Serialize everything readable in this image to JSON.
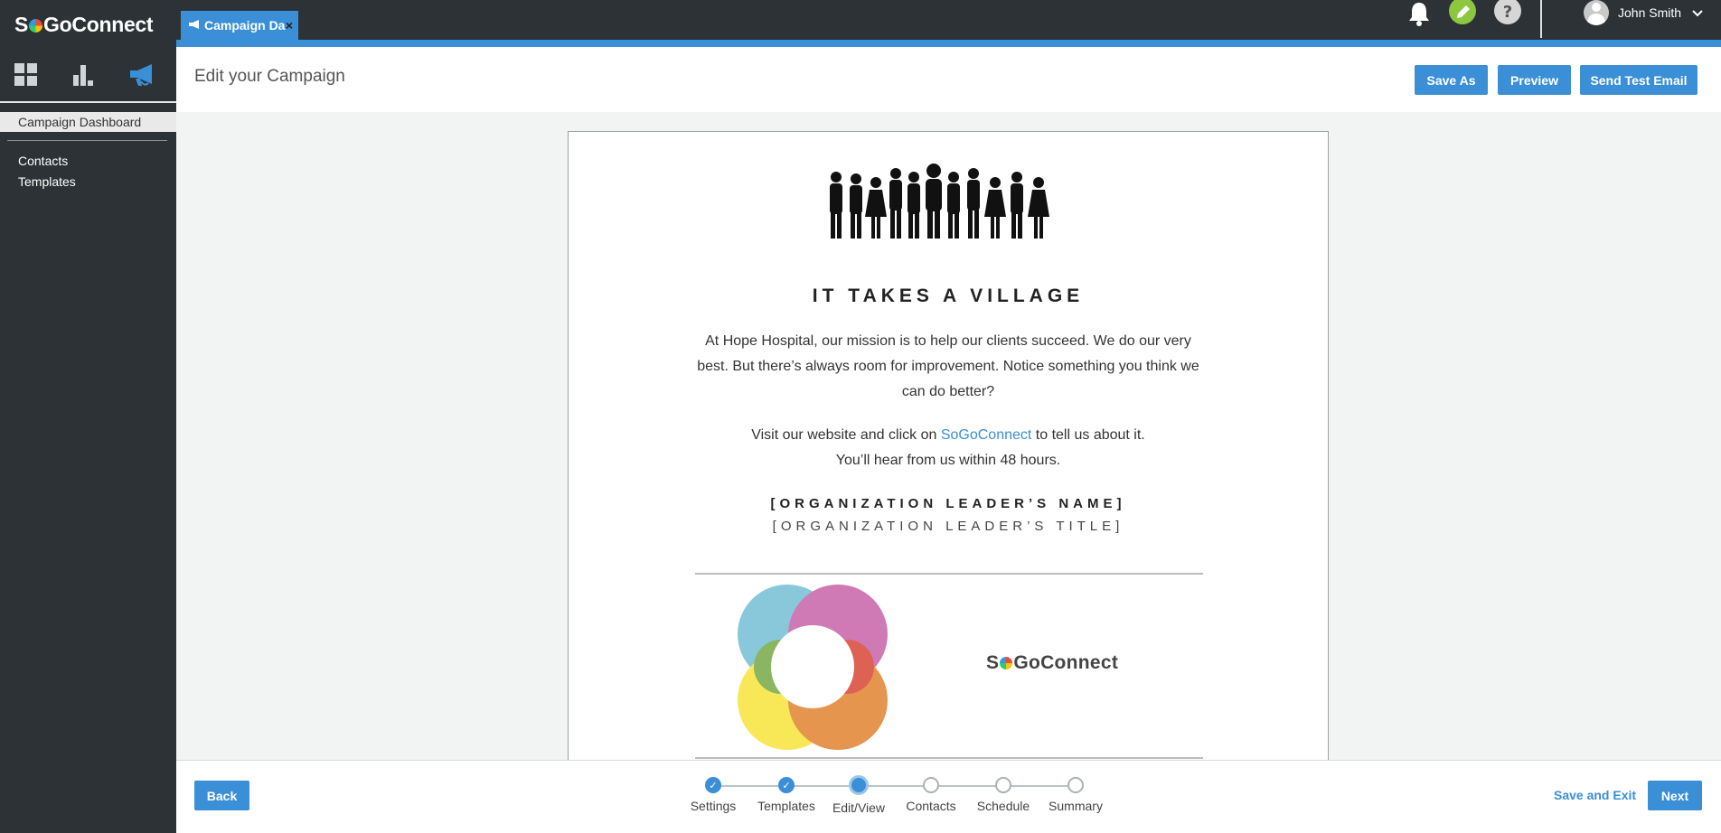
{
  "app": {
    "logo_text_pre": "S",
    "logo_text_post": "GoConnect"
  },
  "sidebar": {
    "icons": [
      "dashboard-grid-icon",
      "bar-chart-icon",
      "megaphone-icon"
    ],
    "active_item": "Campaign Dashboard",
    "links": [
      "Contacts",
      "Templates"
    ]
  },
  "topbar": {
    "tab_label": "Campaign Da",
    "tab_close": "×",
    "icons": [
      "bell-icon",
      "pencil-icon",
      "help-icon"
    ],
    "user_name": "John Smith"
  },
  "header": {
    "title": "Edit your Campaign",
    "save_as": "Save As",
    "preview": "Preview",
    "send_test": "Send Test Email"
  },
  "email": {
    "headline": "IT TAKES A VILLAGE",
    "para1_line1": "At Hope Hospital, our mission is to help our clients succeed. We do our very",
    "para1_line2": "best. But there’s always room for improvement. Notice something you think we",
    "para1_line3": "can do better?",
    "para2_pre": "Visit our website and click on ",
    "para2_link": "SoGoConnect",
    "para2_post": " to tell us about it.",
    "para2_line2": "You’ll hear from us within 48 hours.",
    "leader_name": "[ORGANIZATION LEADER’S NAME]",
    "leader_title": "[ORGANIZATION LEADER’S TITLE]",
    "brand_pre": "S",
    "brand_post": "GoConnect"
  },
  "footer": {
    "back": "Back",
    "steps": [
      {
        "label": "Settings",
        "state": "done"
      },
      {
        "label": "Templates",
        "state": "done"
      },
      {
        "label": "Edit/View",
        "state": "current"
      },
      {
        "label": "Contacts",
        "state": "todo"
      },
      {
        "label": "Schedule",
        "state": "todo"
      },
      {
        "label": "Summary",
        "state": "todo"
      }
    ],
    "save_exit": "Save and Exit",
    "next": "Next"
  },
  "colors": {
    "accent": "#3a8fd6",
    "sidebar": "#2c3236",
    "pencil_green": "#8dc63f"
  }
}
